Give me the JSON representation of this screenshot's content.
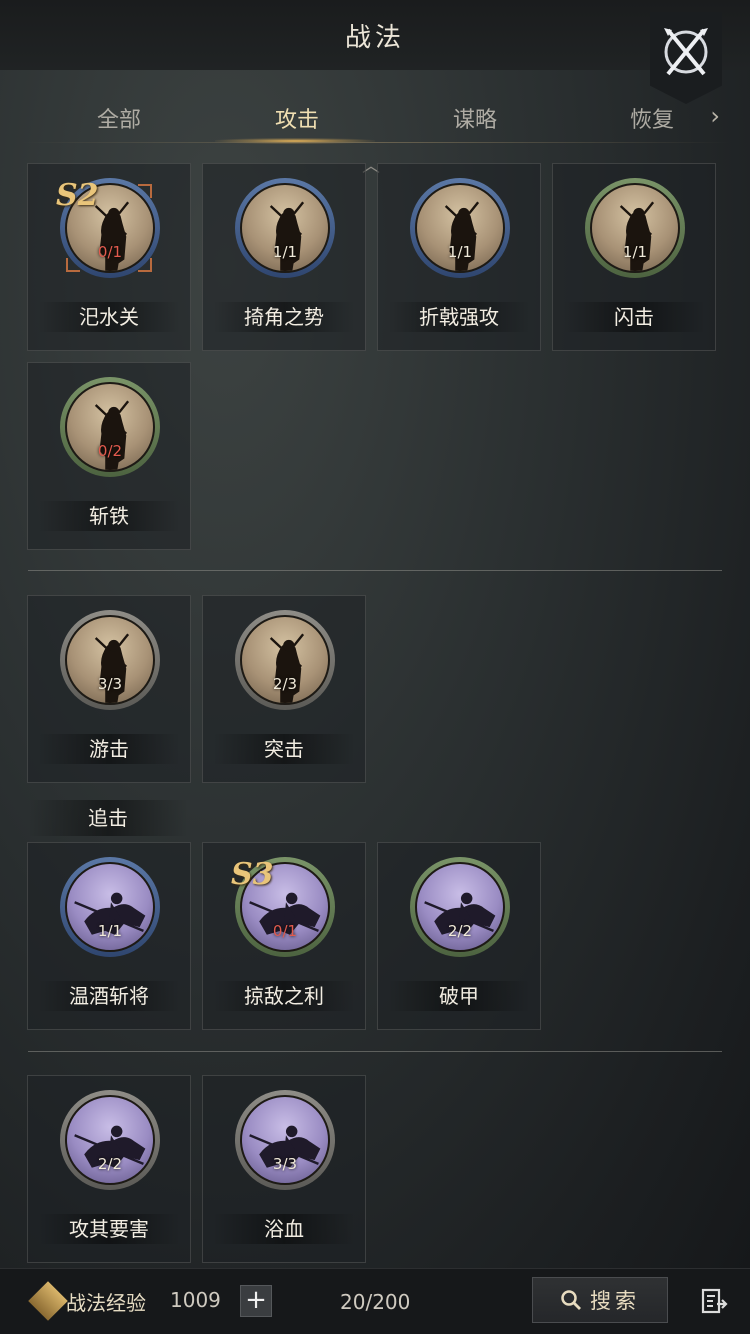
{
  "header": {
    "title": "战法"
  },
  "tabs": [
    {
      "label": "全部",
      "active": false
    },
    {
      "label": "攻击",
      "active": true
    },
    {
      "label": "谋略",
      "active": false
    },
    {
      "label": "恢复",
      "active": false
    }
  ],
  "groups": [
    {
      "cards": [
        {
          "name": "汜水关",
          "count": "0/1",
          "count_red": true,
          "season": "S2",
          "ring": "blue",
          "art": "sepia",
          "selected": true
        },
        {
          "name": "掎角之势",
          "count": "1/1",
          "count_red": false,
          "season": "",
          "ring": "blue",
          "art": "sepia"
        },
        {
          "name": "折戟强攻",
          "count": "1/1",
          "count_red": false,
          "season": "",
          "ring": "blue",
          "art": "sepia"
        },
        {
          "name": "闪击",
          "count": "1/1",
          "count_red": false,
          "season": "",
          "ring": "green",
          "art": "sepia"
        },
        {
          "name": "斩铁",
          "count": "0/2",
          "count_red": true,
          "season": "",
          "ring": "green",
          "art": "sepia"
        }
      ]
    },
    {
      "cards": [
        {
          "name": "游击",
          "count": "3/3",
          "count_red": false,
          "season": "",
          "ring": "gray",
          "art": "sepia"
        },
        {
          "name": "突击",
          "count": "2/3",
          "count_red": false,
          "season": "",
          "ring": "gray",
          "art": "sepia"
        }
      ]
    },
    {
      "label": "追击",
      "cards": [
        {
          "name": "温酒斩将",
          "count": "1/1",
          "count_red": false,
          "season": "",
          "ring": "blue",
          "art": "violet"
        },
        {
          "name": "掠敌之利",
          "count": "0/1",
          "count_red": true,
          "season": "S3",
          "ring": "green",
          "art": "violet"
        },
        {
          "name": "破甲",
          "count": "2/2",
          "count_red": false,
          "season": "",
          "ring": "green",
          "art": "violet"
        }
      ]
    },
    {
      "cards": [
        {
          "name": "攻其要害",
          "count": "2/2",
          "count_red": false,
          "season": "",
          "ring": "gray",
          "art": "violet"
        },
        {
          "name": "浴血",
          "count": "3/3",
          "count_red": false,
          "season": "",
          "ring": "gray",
          "art": "violet"
        }
      ]
    }
  ],
  "footer": {
    "exp_label": "战法经验",
    "exp_value": "1009",
    "capacity": "20/200",
    "search_label": "搜索"
  },
  "colors": {
    "accent_gold": "#e6b45a",
    "count_red": "#e25b4e",
    "ring_blue": "#5b78a6",
    "ring_green": "#7a9468",
    "ring_gray": "#8f8d87"
  },
  "icons": [
    "crossed-swords-icon",
    "chevron-right-icon",
    "chevron-up-icon",
    "plus-icon",
    "search-icon",
    "list-export-icon",
    "exp-badge-icon"
  ]
}
